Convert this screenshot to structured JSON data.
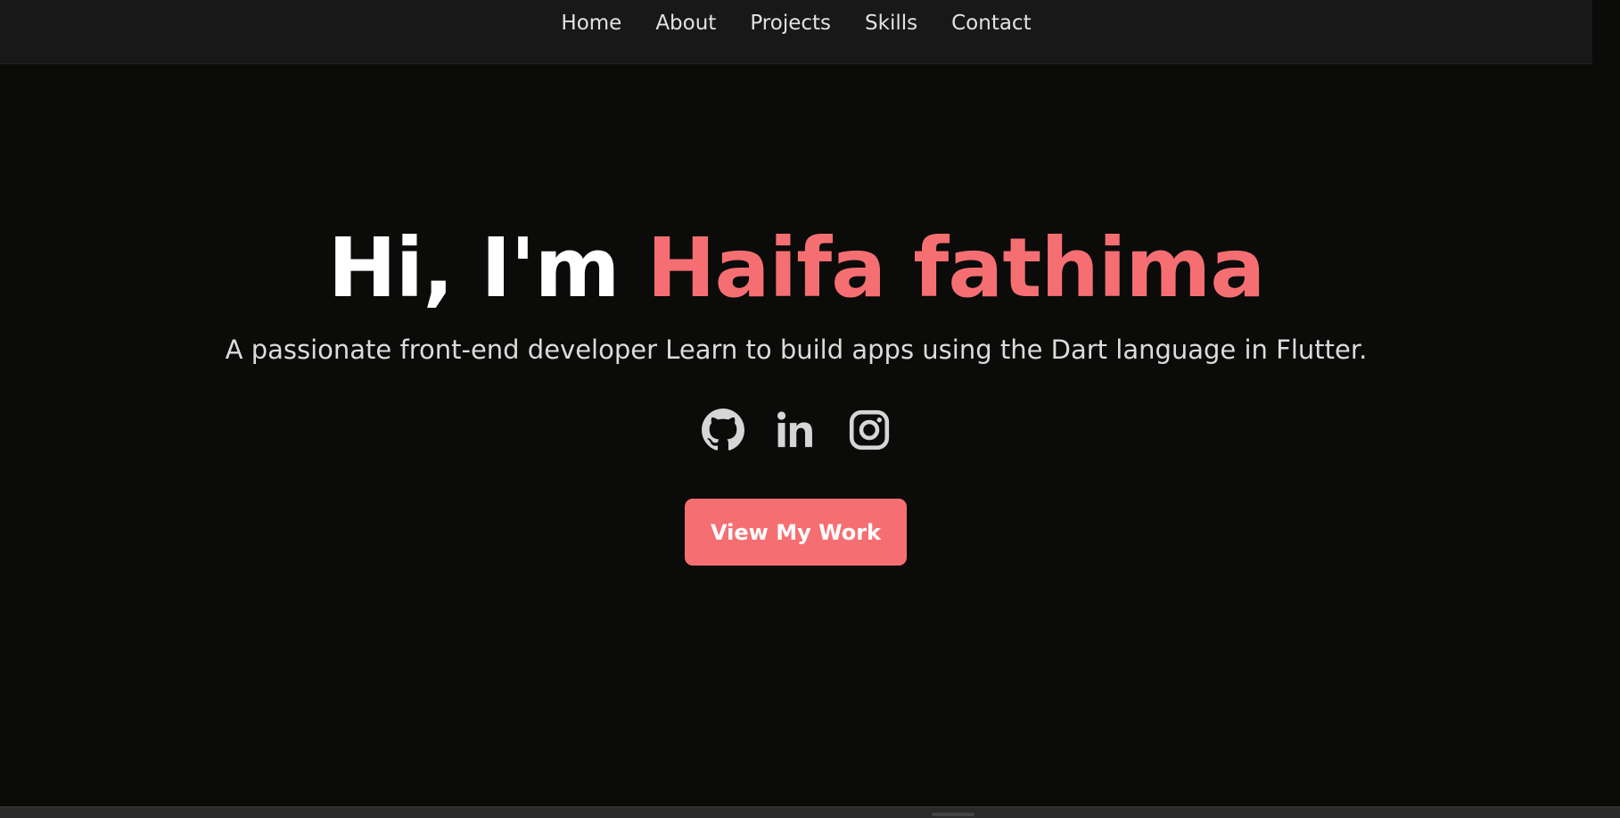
{
  "nav": {
    "items": [
      {
        "label": "Home"
      },
      {
        "label": "About"
      },
      {
        "label": "Projects"
      },
      {
        "label": "Skills"
      },
      {
        "label": "Contact"
      }
    ]
  },
  "hero": {
    "greeting": "Hi, I'm ",
    "name": "Haifa fathima",
    "subtitle": "A passionate front-end developer Learn to build apps using the Dart language in Flutter.",
    "cta_label": "View My Work"
  },
  "socials": [
    {
      "icon": "github-icon"
    },
    {
      "icon": "linkedin-icon"
    },
    {
      "icon": "instagram-icon"
    }
  ],
  "colors": {
    "background": "#0b0b0a",
    "navbar": "#181818",
    "accent": "#f56f72",
    "text": "#ffffff",
    "muted_text": "#dcdcdc",
    "icon": "#d6d6d6"
  }
}
